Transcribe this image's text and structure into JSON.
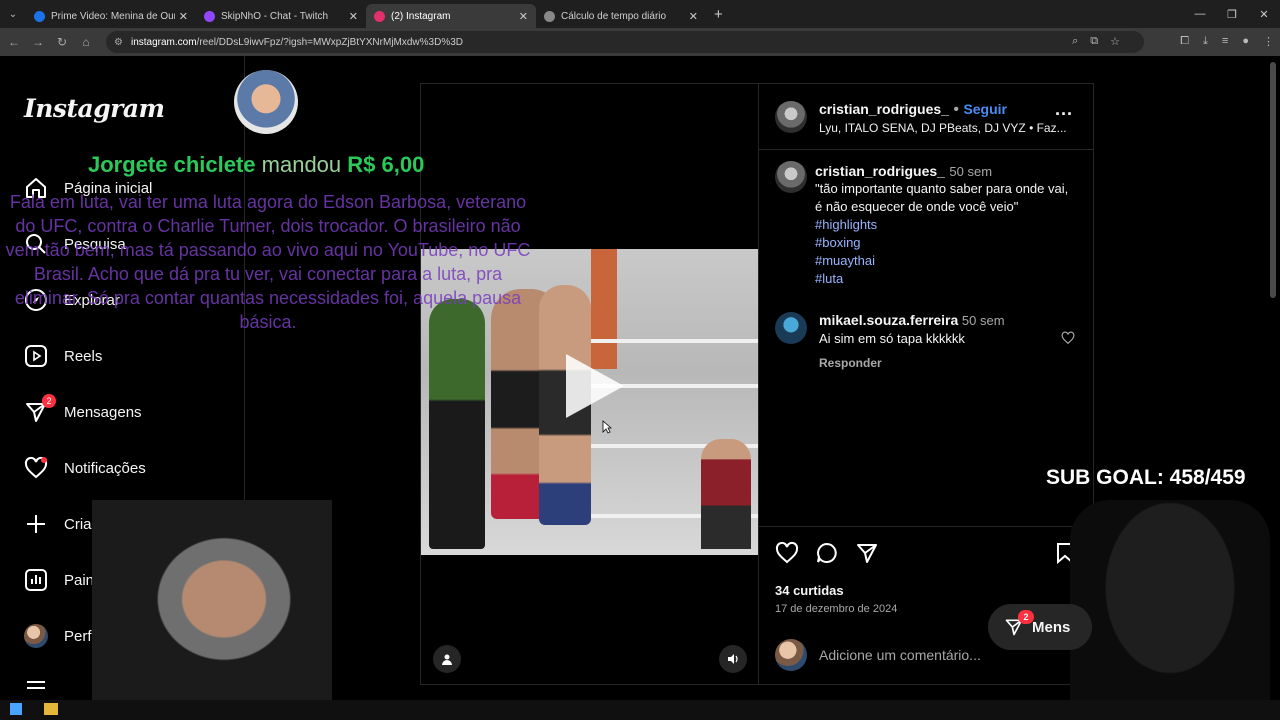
{
  "browser": {
    "tabs": [
      {
        "title": "Prime Video: Menina de Ouro",
        "color": "#1a73e8"
      },
      {
        "title": "SkipNhO - Chat - Twitch",
        "color": "#9146ff"
      },
      {
        "title": "(2) Instagram",
        "color": "#e1306c"
      },
      {
        "title": "Cálculo de tempo diário",
        "color": "#888888"
      }
    ],
    "url_host": "instagram.com",
    "url_path": "/reel/DDsL9iwvFpz/?igsh=MWxpZjBtYXNrMjMxdw%3D%3D"
  },
  "instagram": {
    "logo": "Instagram",
    "nav": [
      {
        "label": "Página inicial",
        "icon": "home-icon"
      },
      {
        "label": "Pesquisa",
        "icon": "search-icon"
      },
      {
        "label": "Explorar",
        "icon": "explore-icon"
      },
      {
        "label": "Reels",
        "icon": "reels-icon"
      },
      {
        "label": "Mensagens",
        "icon": "messages-icon",
        "badge": "2"
      },
      {
        "label": "Notificações",
        "icon": "heart-icon"
      },
      {
        "label": "Criar",
        "icon": "plus-icon"
      },
      {
        "label": "Painel",
        "icon": "dashboard-icon"
      },
      {
        "label": "Perfil",
        "icon": "avatar"
      }
    ]
  },
  "post": {
    "author": "cristian_rodrigues_",
    "follow": "Seguir",
    "audio": "Lyu, ITALO SENA, DJ PBeats, DJ VYZ • Faz...",
    "caption_time": "50 sem",
    "caption": "\"tão importante quanto saber para onde vai, é não esquecer de onde você veio\"",
    "tags": [
      "#highlights",
      "#boxing",
      "#muaythai",
      "#luta"
    ],
    "comment": {
      "user": "mikael.souza.ferreira",
      "time": "50 sem",
      "text": "Ai sim em só tapa kkkkkk",
      "reply": "Responder"
    },
    "likes": "34 curtidas",
    "date": "17 de dezembro de 2024",
    "comment_placeholder": "Adicione um comentário..."
  },
  "overlay": {
    "donor": "Jorgete chiclete",
    "donation_text": "mandou",
    "amount": "R$ 6,00",
    "message": "Fala em luta, vai ter uma luta agora do Edson Barbosa, veterano do UFC, contra o Charlie Turner, dois trocador. O brasileiro não vem tão bem, mas tá passando ao vivo aqui no YouTube, no UFC Brasil. Acho que dá pra tu ver, vai conectar para a luta, pra eliminar. Só pra contar quantas necessidades foi, aquela pausa básica.",
    "sub_goal": "SUB GOAL: 458/459",
    "messages_pill": "Mens",
    "messages_badge": "2"
  }
}
